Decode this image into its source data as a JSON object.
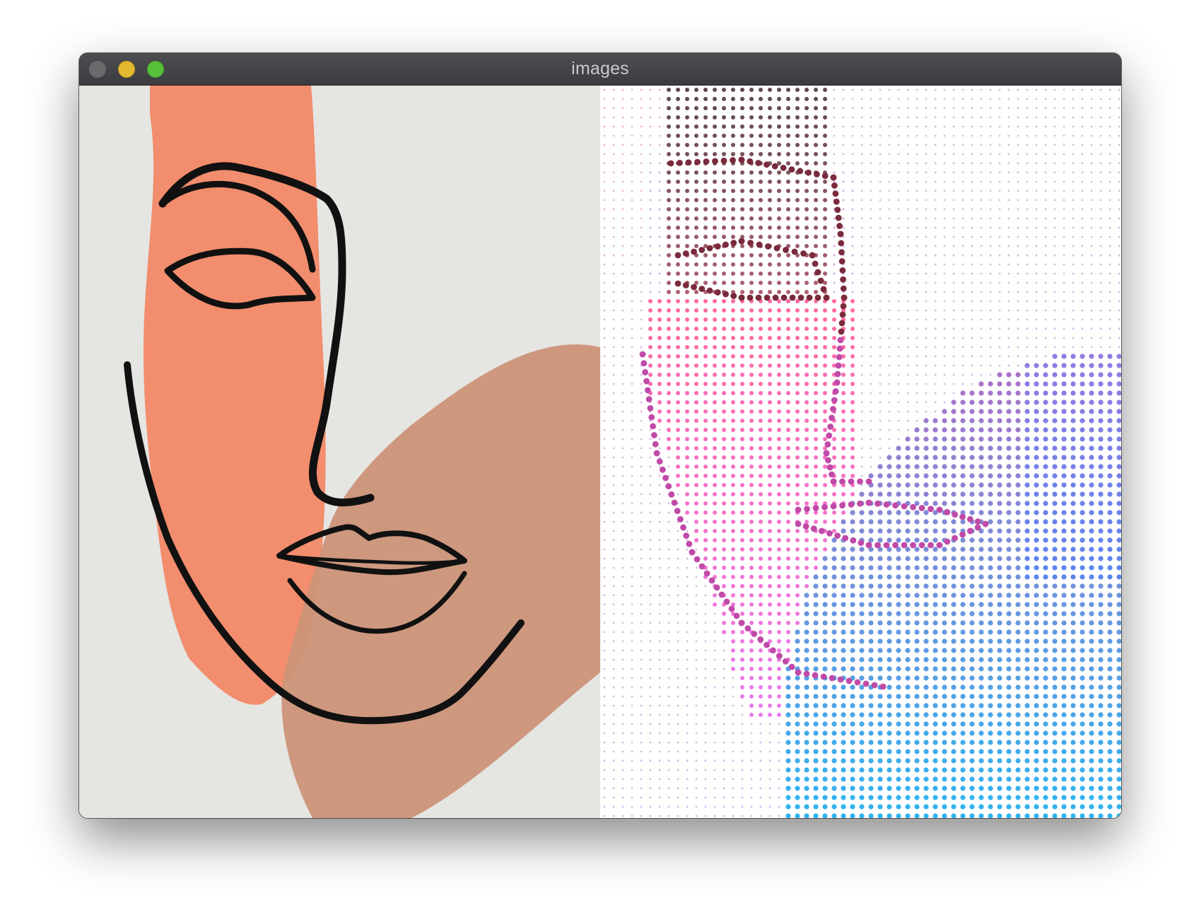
{
  "window": {
    "title": "images",
    "controls": {
      "close": "close-button",
      "minimize": "minimize-button",
      "zoom": "zoom-button"
    },
    "colors": {
      "close": "#6a6a6d",
      "minimize": "#e2b92f",
      "zoom": "#58c13b"
    }
  },
  "images": {
    "original": {
      "description_icon": "face-line-art",
      "background": "#e5e5e2",
      "shape_colors": [
        "#f28d6d",
        "#cc9378"
      ],
      "line_color": "#111111"
    },
    "halftone": {
      "description_icon": "halftone-dots",
      "background": "#ffffff",
      "dot_colors": [
        "#7a3c4a",
        "#ff5fa8",
        "#ee73f0",
        "#6a78ee",
        "#3bb8f0"
      ]
    }
  }
}
